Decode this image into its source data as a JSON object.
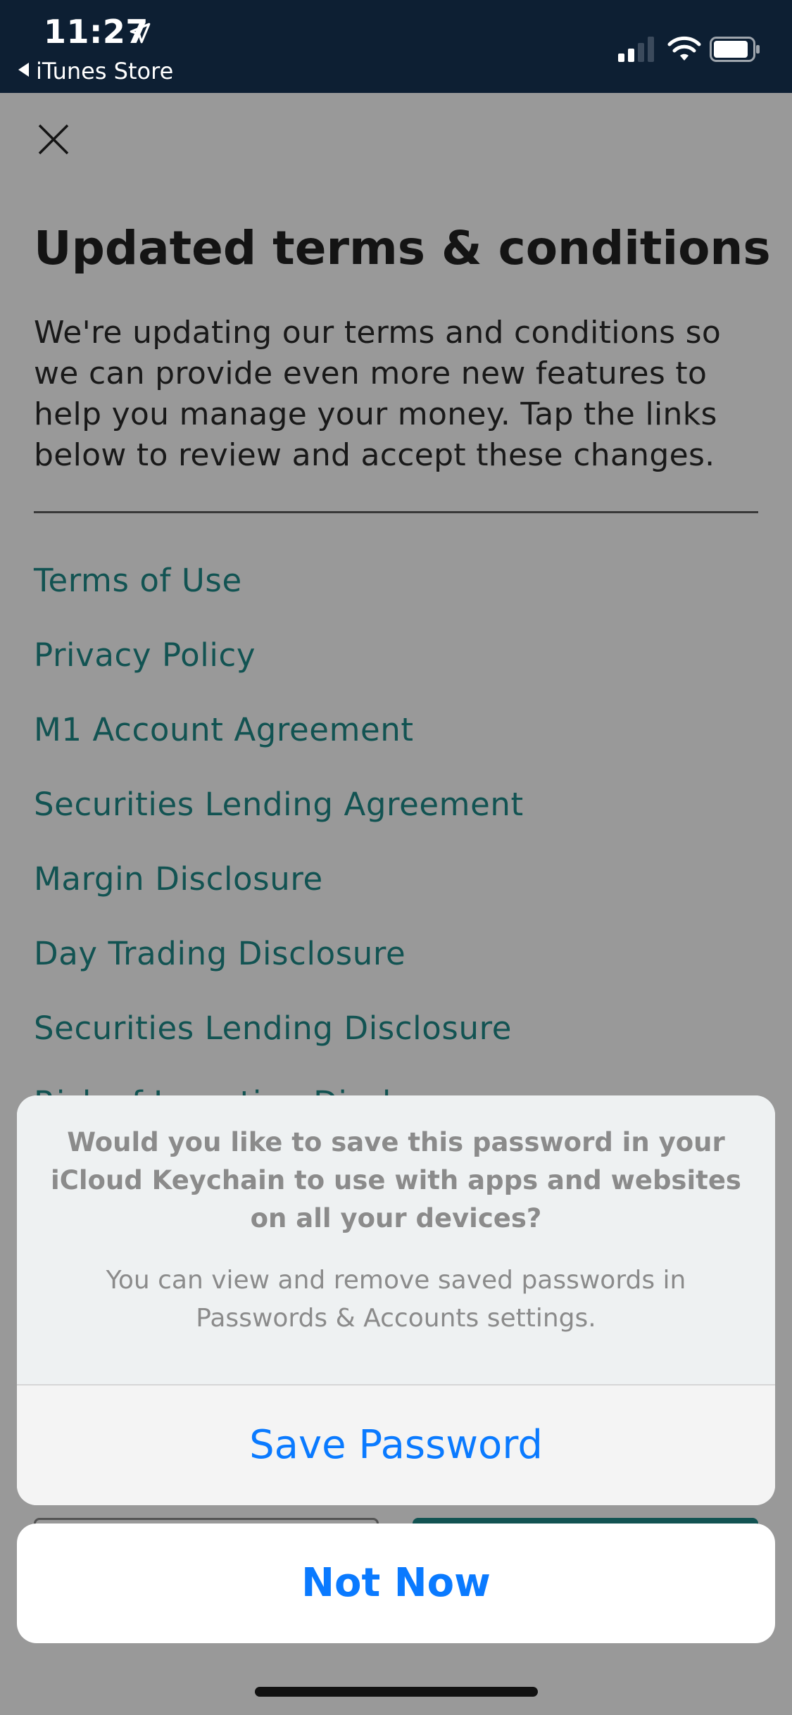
{
  "status_bar": {
    "time": "11:27",
    "back_app": "iTunes Store"
  },
  "page": {
    "title": "Updated terms & conditions",
    "intro": "We're updating our terms and conditions so we can provide even more new features to help you manage your money. Tap the links below to review and accept these changes.",
    "links": [
      "Terms of Use",
      "Privacy Policy",
      "M1 Account Agreement",
      "Securities Lending Agreement",
      "Margin Disclosure",
      "Day Trading Disclosure",
      "Securities Lending Disclosure",
      "Risk of Investing Disclosure"
    ]
  },
  "action_sheet": {
    "message": "Would you like to save this password in your iCloud Keychain to use with apps and websites on all your devices?",
    "submessage": "You can view and remove saved passwords in Passwords & Accounts settings.",
    "save_label": "Save Password",
    "cancel_label": "Not Now"
  },
  "icons": {
    "close": "close-icon",
    "location": "location-arrow-icon",
    "signal": "cellular-signal-icon",
    "wifi": "wifi-icon",
    "battery": "battery-icon"
  },
  "colors": {
    "status_bar": "#0d1f33",
    "link": "#1e8a89",
    "ios_blue": "#0a7aff",
    "title": "#222222"
  }
}
